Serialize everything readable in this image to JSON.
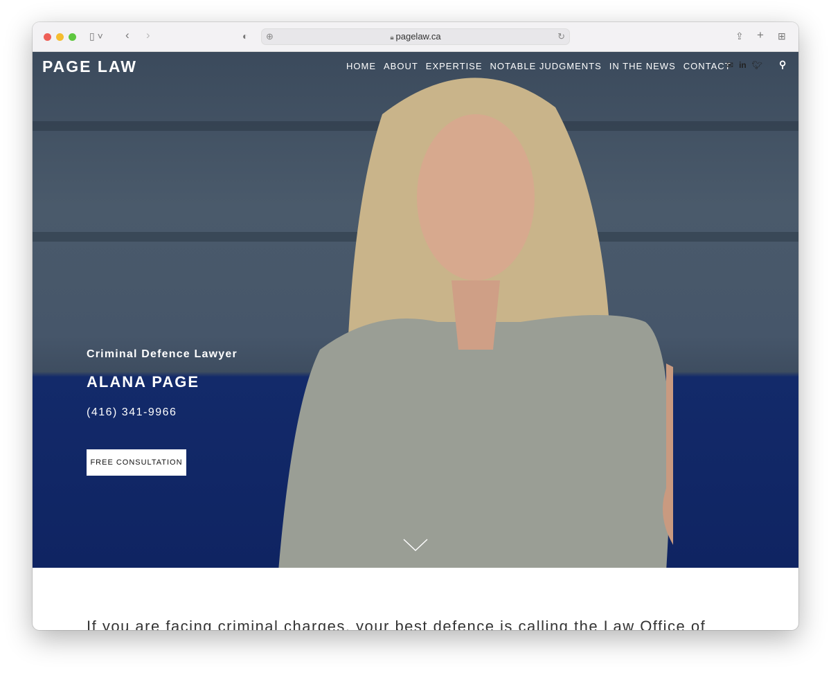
{
  "browser": {
    "url": "pagelaw.ca"
  },
  "nav": {
    "logo": "PAGE LAW",
    "items": [
      "HOME",
      "ABOUT",
      "EXPERTISE",
      "NOTABLE JUDGMENTS",
      "IN THE NEWS",
      "CONTACT"
    ],
    "social": [
      "mail-icon",
      "linkedin-icon",
      "twitter-icon"
    ]
  },
  "hero": {
    "subtitle": "Criminal Defence Lawyer",
    "name": "ALANA PAGE",
    "phone": "(416) 341-9966",
    "cta": "FREE CONSULTATION"
  },
  "intro": {
    "text": "If you are facing criminal charges, your best defence is calling the Law Office of"
  }
}
